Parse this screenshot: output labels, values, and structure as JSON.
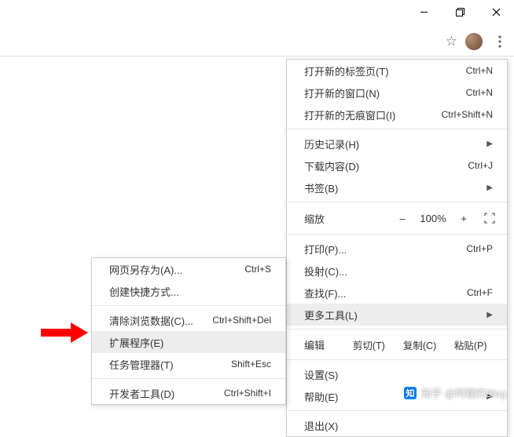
{
  "window_controls": {
    "minimize": "–",
    "maximize": "❐",
    "close": "✕"
  },
  "toolbar": {
    "star_tip": "bookmark",
    "avatar_tip": "profile",
    "menu_tip": "menu"
  },
  "main_menu": {
    "new_tab": {
      "label": "打开新的标签页(T)",
      "shortcut": "Ctrl+N"
    },
    "new_window": {
      "label": "打开新的窗口(N)",
      "shortcut": "Ctrl+N"
    },
    "new_incognito": {
      "label": "打开新的无痕窗口(I)",
      "shortcut": "Ctrl+Shift+N"
    },
    "history": {
      "label": "历史记录(H)"
    },
    "downloads": {
      "label": "下载内容(D)",
      "shortcut": "Ctrl+J"
    },
    "bookmarks": {
      "label": "书签(B)"
    },
    "zoom": {
      "label": "缩放",
      "minus": "–",
      "value": "100%",
      "plus": "+"
    },
    "print": {
      "label": "打印(P)...",
      "shortcut": "Ctrl+P"
    },
    "cast": {
      "label": "投射(C)..."
    },
    "find": {
      "label": "查找(F)...",
      "shortcut": "Ctrl+F"
    },
    "more_tools": {
      "label": "更多工具(L)"
    },
    "edit": {
      "label": "编辑",
      "cut": "剪切(T)",
      "copy": "复制(C)",
      "paste": "粘贴(P)"
    },
    "settings": {
      "label": "设置(S)"
    },
    "help": {
      "label": "帮助(E)"
    },
    "exit": {
      "label": "退出(X)"
    }
  },
  "sub_menu": {
    "save_page": {
      "label": "网页另存为(A)...",
      "shortcut": "Ctrl+S"
    },
    "create_shortcut": {
      "label": "创建快捷方式..."
    },
    "clear_data": {
      "label": "清除浏览数据(C)...",
      "shortcut": "Ctrl+Shift+Del"
    },
    "extensions": {
      "label": "扩展程序(E)"
    },
    "task_manager": {
      "label": "任务管理器(T)",
      "shortcut": "Shift+Esc"
    },
    "dev_tools": {
      "label": "开发者工具(D)",
      "shortcut": "Ctrl+Shift+I"
    }
  },
  "watermark": {
    "text": "知乎 @阿狸的Blog"
  }
}
